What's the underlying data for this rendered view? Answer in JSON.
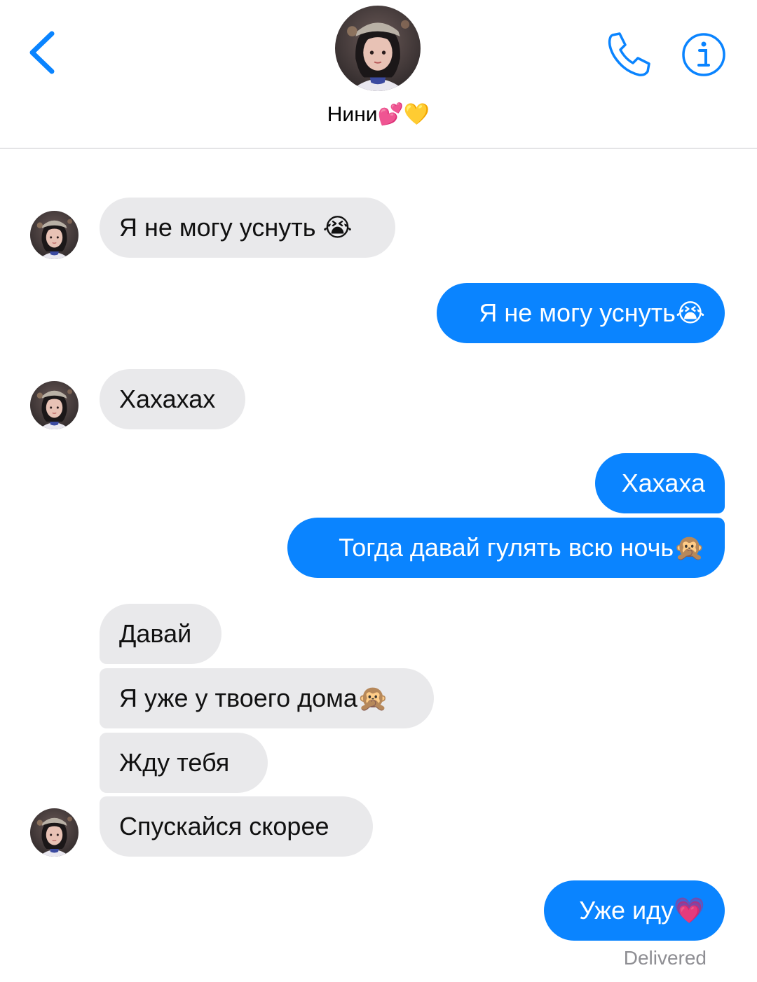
{
  "header": {
    "contact_name": "Нини💕💛",
    "icons": {
      "back": "chevron-left-icon",
      "call": "phone-icon",
      "info": "info-icon"
    },
    "accent_color": "#0a84ff"
  },
  "messages": [
    {
      "direction": "incoming",
      "text": "Я не могу уснуть 😭",
      "avatar": true
    },
    {
      "direction": "outgoing",
      "text": "Я не могу уснуть😭"
    },
    {
      "direction": "incoming",
      "text": "Хахахах",
      "avatar": true
    },
    {
      "direction": "outgoing",
      "text": "Хахаха"
    },
    {
      "direction": "outgoing",
      "text": "Тогда давай гулять всю ночь🙊"
    },
    {
      "direction": "incoming",
      "text": "Давай"
    },
    {
      "direction": "incoming",
      "text": "Я уже у твоего дома🙊"
    },
    {
      "direction": "incoming",
      "text": "Жду тебя"
    },
    {
      "direction": "incoming",
      "text": "Спускайся скорее",
      "avatar": true
    },
    {
      "direction": "outgoing",
      "text": "Уже иду💗"
    }
  ],
  "status": {
    "delivered": "Delivered"
  },
  "colors": {
    "incoming_bubble": "#e9e9eb",
    "outgoing_bubble": "#0a84ff",
    "status_text": "#8e8e93"
  }
}
